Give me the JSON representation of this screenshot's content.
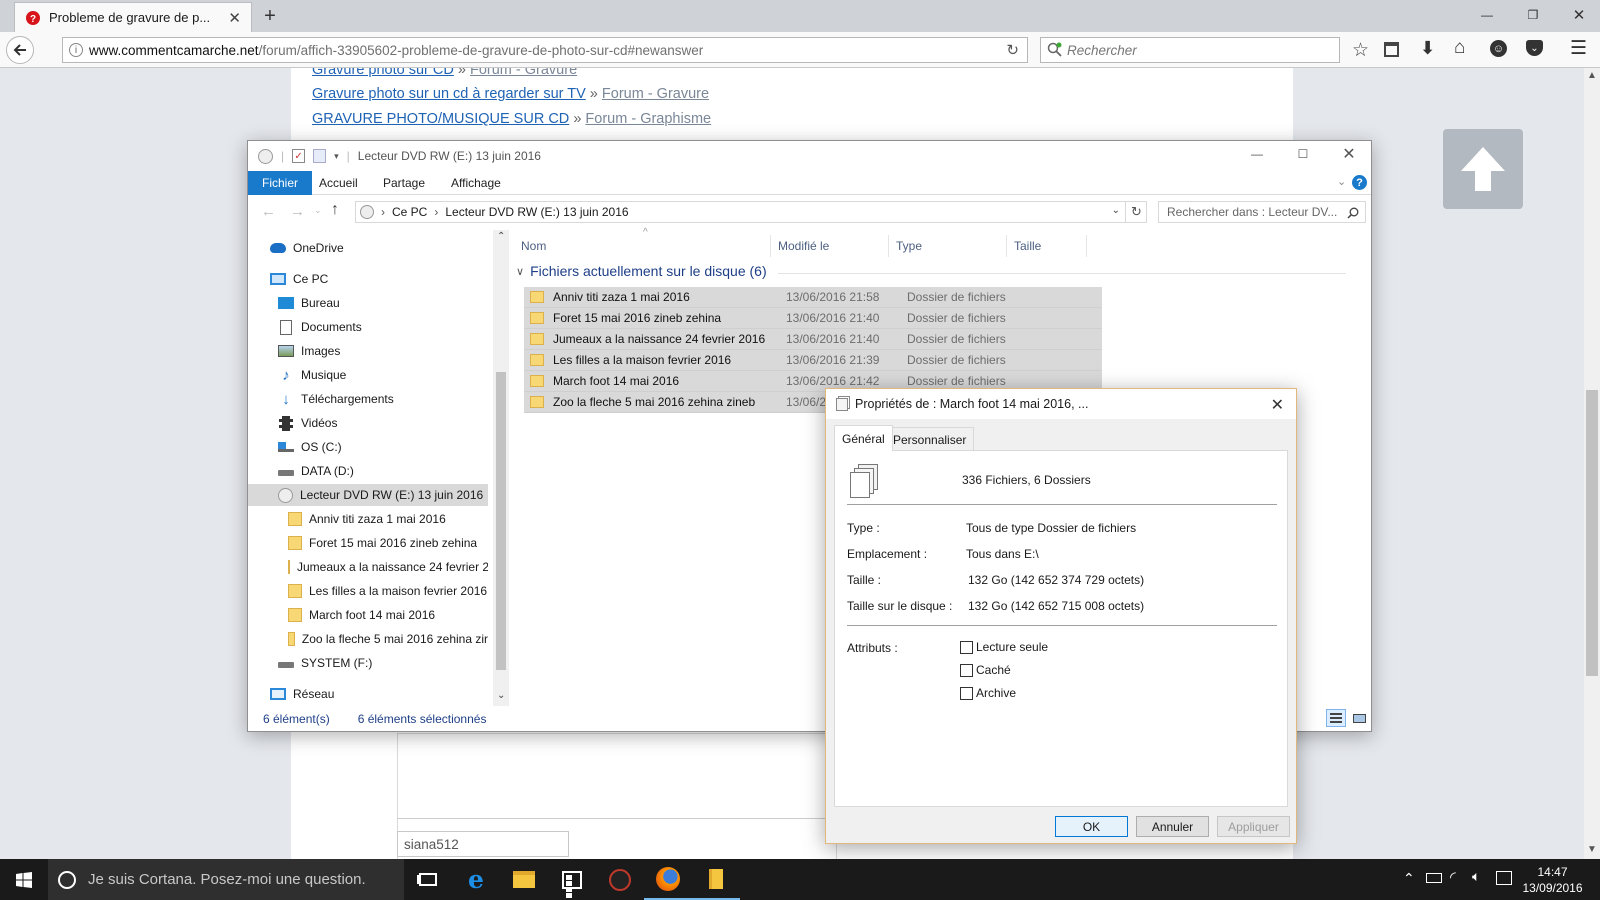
{
  "browser": {
    "tab_title": "Probleme de gravure de p...",
    "url_domain": "www.commentcamarche.net",
    "url_path": "/forum/affich-33905602-probleme-de-gravure-de-photo-sur-cd#newanswer",
    "search_placeholder": "Rechercher"
  },
  "page": {
    "links": [
      {
        "title": "Gravure photo sur CD",
        "sep": "»",
        "forum": "Forum - Gravure"
      },
      {
        "title": "Gravure photo sur un cd à regarder sur TV",
        "sep": "»",
        "forum": "Forum - Gravure"
      },
      {
        "title": "GRAVURE PHOTO/MUSIQUE SUR CD",
        "sep": "»",
        "forum": "Forum - Graphisme"
      }
    ],
    "username": "siana512"
  },
  "explorer": {
    "title": "Lecteur DVD RW (E:) 13 juin 2016",
    "ribbon_tabs": [
      "Fichier",
      "Accueil",
      "Partage",
      "Affichage"
    ],
    "breadcrumb": [
      "Ce PC",
      "Lecteur DVD RW (E:) 13 juin 2016"
    ],
    "search_placeholder": "Rechercher dans : Lecteur DV...",
    "nav": {
      "onedrive": "OneDrive",
      "this_pc": "Ce PC",
      "bureau": "Bureau",
      "documents": "Documents",
      "images": "Images",
      "musique": "Musique",
      "telechargements": "Téléchargements",
      "videos": "Vidéos",
      "os_c": "OS (C:)",
      "data_d": "DATA (D:)",
      "dvd_e": "Lecteur DVD RW (E:) 13 juin 2016",
      "folders": [
        "Anniv titi zaza 1 mai 2016",
        "Foret 15 mai 2016 zineb zehina",
        "Jumeaux a la naissance 24 fevrier 2",
        "Les filles a la maison fevrier 2016",
        "March foot 14 mai 2016",
        "Zoo la fleche 5 mai 2016 zehina zir"
      ],
      "system_f": "SYSTEM (F:)",
      "reseau": "Réseau"
    },
    "columns": [
      "Nom",
      "Modifié le",
      "Type",
      "Taille"
    ],
    "group_label": "Fichiers actuellement sur le disque (6)",
    "files": [
      {
        "name": "Anniv titi zaza 1 mai 2016",
        "date": "13/06/2016 21:58",
        "type": "Dossier de fichiers"
      },
      {
        "name": "Foret 15 mai 2016 zineb zehina",
        "date": "13/06/2016 21:40",
        "type": "Dossier de fichiers"
      },
      {
        "name": "Jumeaux a la naissance 24 fevrier 2016",
        "date": "13/06/2016 21:40",
        "type": "Dossier de fichiers"
      },
      {
        "name": "Les filles a la maison fevrier 2016",
        "date": "13/06/2016 21:39",
        "type": "Dossier de fichiers"
      },
      {
        "name": "March foot 14 mai 2016",
        "date": "13/06/2016 21:42",
        "type": "Dossier de fichiers"
      },
      {
        "name": "Zoo la fleche 5 mai 2016 zehina zineb",
        "date": "13/06/2",
        "type": ""
      }
    ],
    "status_count": "6 élément(s)",
    "status_selected": "6 éléments sélectionnés"
  },
  "properties": {
    "title": "Propriétés de : March foot 14 mai 2016, ...",
    "tabs": [
      "Général",
      "Personnaliser"
    ],
    "summary": "336 Fichiers, 6 Dossiers",
    "type_label": "Type :",
    "type_value": "Tous de type Dossier de fichiers",
    "location_label": "Emplacement :",
    "location_value": "Tous dans E:\\",
    "size_label": "Taille :",
    "size_value": "132 Go (142 652 374 729 octets)",
    "disk_size_label": "Taille sur le disque :",
    "disk_size_value": "132 Go (142 652 715 008 octets)",
    "attributes_label": "Attributs :",
    "attr_readonly": "Lecture seule",
    "attr_hidden": "Caché",
    "attr_archive": "Archive",
    "ok": "OK",
    "cancel": "Annuler",
    "apply": "Appliquer"
  },
  "taskbar": {
    "cortana_text": "Je suis Cortana. Posez-moi une question.",
    "time": "14:47",
    "date": "13/09/2016"
  },
  "colors": {
    "explorer_accent": "#1979ca",
    "link": "#1f63b5",
    "selection": "#d9d9d9"
  }
}
